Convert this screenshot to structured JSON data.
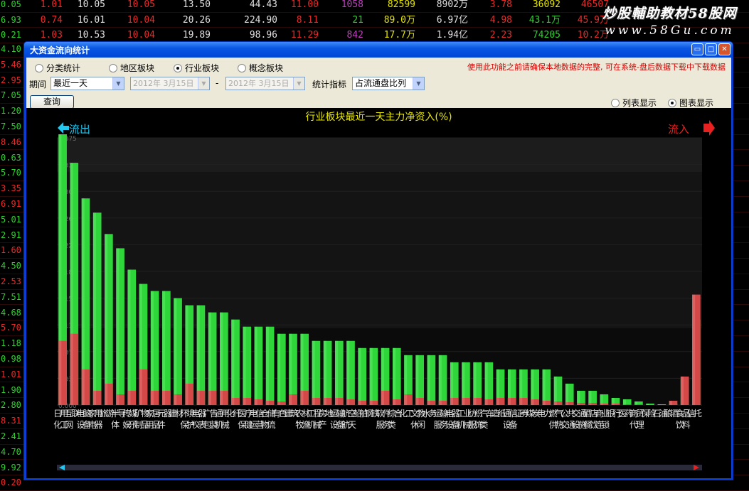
{
  "bg_rows": [
    {
      "left": "0.05",
      "cells": [
        {
          "text": "1.01",
          "color": "#e62b2b"
        },
        {
          "text": "10.05",
          "color": "#e0e0e0"
        },
        {
          "text": "10.05",
          "color": "#e62b2b"
        },
        {
          "text": "13.50",
          "color": "#e0e0e0"
        },
        {
          "text": "44.43",
          "color": "#e0e0e0"
        },
        {
          "text": "11.00",
          "color": "#e62b2b"
        },
        {
          "text": "1058",
          "color": "#c040c0"
        },
        {
          "text": "82599",
          "color": "#e6e600"
        },
        {
          "text": "8902万",
          "color": "#e0e0e0"
        },
        {
          "text": "3.78",
          "color": "#e62b2b"
        },
        {
          "text": "36092",
          "color": "#e6e600"
        },
        {
          "text": "46507",
          "color": "#e62b2b"
        }
      ]
    },
    {
      "left": "6.93",
      "cells": [
        {
          "text": "0.74",
          "color": "#e62b2b"
        },
        {
          "text": "16.01",
          "color": "#e0e0e0"
        },
        {
          "text": "10.04",
          "color": "#e62b2b"
        },
        {
          "text": "20.26",
          "color": "#e0e0e0"
        },
        {
          "text": "224.90",
          "color": "#e0e0e0"
        },
        {
          "text": "8.11",
          "color": "#e62b2b"
        },
        {
          "text": "21",
          "color": "#30d030"
        },
        {
          "text": "89.0万",
          "color": "#e6e600"
        },
        {
          "text": "6.97亿",
          "color": "#e0e0e0"
        },
        {
          "text": "4.98",
          "color": "#e62b2b"
        },
        {
          "text": "43.1万",
          "color": "#30d030"
        },
        {
          "text": "45.9万",
          "color": "#e62b2b"
        }
      ]
    },
    {
      "left": "0.21",
      "cells": [
        {
          "text": "1.03",
          "color": "#e62b2b"
        },
        {
          "text": "10.53",
          "color": "#e0e0e0"
        },
        {
          "text": "10.04",
          "color": "#e62b2b"
        },
        {
          "text": "19.89",
          "color": "#e0e0e0"
        },
        {
          "text": "98.96",
          "color": "#e0e0e0"
        },
        {
          "text": "11.29",
          "color": "#e62b2b"
        },
        {
          "text": "842",
          "color": "#c040c0"
        },
        {
          "text": "17.7万",
          "color": "#e6e600"
        },
        {
          "text": "1.94亿",
          "color": "#e0e0e0"
        },
        {
          "text": "2.23",
          "color": "#e62b2b"
        },
        {
          "text": "74205",
          "color": "#30d030"
        },
        {
          "text": "10.2万",
          "color": "#e62b2b"
        }
      ]
    }
  ],
  "left_column": [
    "4.10",
    "5.46",
    "2.95",
    "7.05",
    "1.20",
    "7.50",
    "8.46",
    "0.63",
    "5.70",
    "3.35",
    "6.91",
    "5.01",
    "2.91",
    "1.60",
    "4.50",
    "2.53",
    "7.51",
    "4.68",
    "5.70",
    "1.18",
    "0.98",
    "1.01",
    "1.90",
    "2.80",
    "8.31",
    "2.41",
    "4.70",
    "9.92",
    "0.20"
  ],
  "left_column_colors": [
    "#30d030",
    "#e62b2b",
    "#e62b2b",
    "#30d030",
    "#30d030",
    "#30d030",
    "#e62b2b",
    "#30d030",
    "#30d030",
    "#e62b2b",
    "#e62b2b",
    "#30d030",
    "#30d030",
    "#e62b2b",
    "#30d030",
    "#e62b2b",
    "#30d030",
    "#30d030",
    "#e62b2b",
    "#30d030",
    "#30d030",
    "#e62b2b",
    "#30d030",
    "#30d030",
    "#e62b2b",
    "#30d030",
    "#30d030",
    "#30d030",
    "#e62b2b"
  ],
  "watermark": {
    "line1": "炒股輔助教材58股网",
    "line2": "www.58Gu.com"
  },
  "dialog": {
    "title": "大资金流向统计",
    "buttons": {
      "minimize": "▭",
      "restore": "□",
      "close": "✕"
    },
    "radios": [
      {
        "label": "分类统计",
        "checked": false
      },
      {
        "label": "地区板块",
        "checked": false
      },
      {
        "label": "行业板块",
        "checked": true
      },
      {
        "label": "概念板块",
        "checked": false
      }
    ],
    "period_label": "期间",
    "period_value": "最近一天",
    "date_from": "2012年 3月15日",
    "date_sep": "-",
    "date_to": "2012年 3月15日",
    "metric_label": "统计指标",
    "metric_value": "占流通盘比列",
    "query_label": "查询",
    "note": "使用此功能之前请确保本地数据的完整, 可在系统-盘后数据下载中下载数据",
    "view_list": "列表显示",
    "view_chart": "图表显示",
    "view_selected": "chart"
  },
  "chart_data": {
    "type": "bar",
    "title": "行业板块最近一天主力净资入(%)",
    "outflow_label": "流出",
    "inflow_label": "流入",
    "y_ticks": [
      "0.375",
      "0.336",
      "0.301",
      "0.263",
      "0.226",
      "0.188",
      "0.150",
      "0.113",
      "0.075",
      "0.038",
      "0.000"
    ],
    "categories": [
      "日用化工",
      "互联网",
      "电脑设备",
      "家用电器",
      "旅游",
      "半导体",
      "传媒娱乐",
      "矿物制品",
      "家居用品",
      "元器件",
      "建材",
      "环境保护",
      "电器仪表",
      "广告包装",
      "通用机械",
      "化纤",
      "医疗保健",
      "电信运营",
      "仓储物流",
      "有色",
      "建筑",
      "农林牧渔",
      "工程机械",
      "房地产",
      "运输设备",
      "航空航天",
      "船舶",
      "钢铁",
      "软件服务",
      "综合类",
      "化工",
      "文教休闲",
      "水务",
      "运输服务",
      "电器设备",
      "工业机械",
      "纺织服饰",
      "汽车类",
      "造纸",
      "通信设备",
      "证券",
      "煤炭",
      "电力",
      "燃气供热",
      "公共交通",
      "交通设施",
      "酒店餐饮",
      "商业连锁",
      "银行",
      "医药",
      "商贸代理",
      "保险",
      "石油",
      "酿酒",
      "食品饮料",
      "信托"
    ],
    "outflow": [
      0.38,
      0.34,
      0.29,
      0.27,
      0.24,
      0.22,
      0.19,
      0.17,
      0.16,
      0.16,
      0.15,
      0.14,
      0.14,
      0.13,
      0.13,
      0.12,
      0.11,
      0.11,
      0.11,
      0.1,
      0.1,
      0.1,
      0.09,
      0.09,
      0.09,
      0.09,
      0.08,
      0.08,
      0.08,
      0.08,
      0.07,
      0.07,
      0.07,
      0.07,
      0.06,
      0.06,
      0.06,
      0.06,
      0.05,
      0.05,
      0.05,
      0.05,
      0.05,
      0.04,
      0.03,
      0.02,
      0.02,
      0.015,
      0.01,
      0.008,
      0.005,
      0.002,
      0.001,
      0.0,
      0.0,
      0.0
    ],
    "outflow_red": [
      0.09,
      0.1,
      0.05,
      0.02,
      0.03,
      0.015,
      0.02,
      0.05,
      0.02,
      0.02,
      0.015,
      0.03,
      0.02,
      0.02,
      0.02,
      0.01,
      0.01,
      0.008,
      0.006,
      0.005,
      0.015,
      0.02,
      0.01,
      0.01,
      0.01,
      0.008,
      0.006,
      0.006,
      0.02,
      0.008,
      0.015,
      0.01,
      0.006,
      0.006,
      0.01,
      0.01,
      0.01,
      0.008,
      0.01,
      0.01,
      0.01,
      0.008,
      0.006,
      0.005,
      0.004,
      0.003,
      0.003,
      0.002,
      0.002,
      0.001,
      0.001,
      0.0,
      0.0,
      0.0,
      0.0,
      0.0
    ],
    "inflow": [
      0.0,
      0.0,
      0.0,
      0.0,
      0.0,
      0.0,
      0.0,
      0.0,
      0.0,
      0.0,
      0.0,
      0.0,
      0.0,
      0.0,
      0.0,
      0.0,
      0.0,
      0.0,
      0.0,
      0.0,
      0.0,
      0.0,
      0.0,
      0.0,
      0.0,
      0.0,
      0.0,
      0.0,
      0.0,
      0.0,
      0.0,
      0.0,
      0.0,
      0.0,
      0.0,
      0.0,
      0.0,
      0.0,
      0.0,
      0.0,
      0.0,
      0.0,
      0.0,
      0.0,
      0.0,
      0.0,
      0.0,
      0.0,
      0.0,
      0.0,
      0.0,
      0.0,
      0.0,
      0.002,
      0.036,
      0.12
    ],
    "inflow_red": [
      0.0,
      0.0,
      0.0,
      0.0,
      0.0,
      0.0,
      0.0,
      0.0,
      0.0,
      0.0,
      0.0,
      0.0,
      0.0,
      0.0,
      0.0,
      0.0,
      0.0,
      0.0,
      0.0,
      0.0,
      0.0,
      0.0,
      0.0,
      0.0,
      0.0,
      0.0,
      0.0,
      0.0,
      0.0,
      0.0,
      0.0,
      0.0,
      0.0,
      0.0,
      0.0,
      0.0,
      0.0,
      0.0,
      0.0,
      0.0,
      0.0,
      0.0,
      0.0,
      0.0,
      0.0,
      0.0,
      0.0,
      0.0,
      0.0,
      0.0,
      0.0,
      0.0,
      0.0,
      0.006,
      0.04,
      0.155
    ],
    "ylim": [
      0,
      0.375
    ],
    "colors": {
      "green": "#2fd63a",
      "red": "#d44848",
      "title": "#e6e600",
      "arrow": "#22c8f0",
      "inflow_arrow": "#e82020",
      "grid": "#1a1a1a",
      "tick": "#6a6a6a",
      "label": "#e0e0e0"
    }
  }
}
